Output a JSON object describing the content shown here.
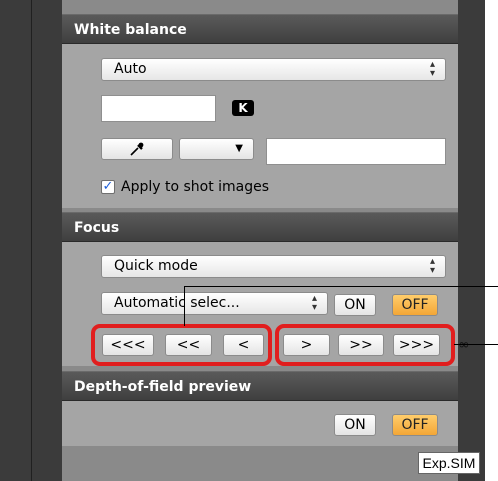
{
  "white_balance": {
    "title": "White balance",
    "mode_value": "Auto",
    "kelvin_value": "",
    "kelvin_badge": "K",
    "eyedropper_icon": "eyedropper-icon",
    "small_select_value": "",
    "custom_field_value": "",
    "apply_checked": true,
    "apply_label": "Apply to shot images"
  },
  "focus": {
    "title": "Focus",
    "mode_value": "Quick mode",
    "af_point_value": "Automatic selec...",
    "on_label": "ON",
    "off_label": "OFF",
    "near_buttons": [
      "<<<",
      "<<",
      "<"
    ],
    "far_buttons": [
      ">",
      ">>",
      ">>>"
    ]
  },
  "depth_of_field": {
    "title": "Depth-of-field preview",
    "on_label": "ON",
    "off_label": "OFF"
  },
  "footer": {
    "exp_sim_label": "Exp.SIM"
  },
  "colors": {
    "accent_off": "#f3a636",
    "annotation_red": "#e11e1e"
  }
}
